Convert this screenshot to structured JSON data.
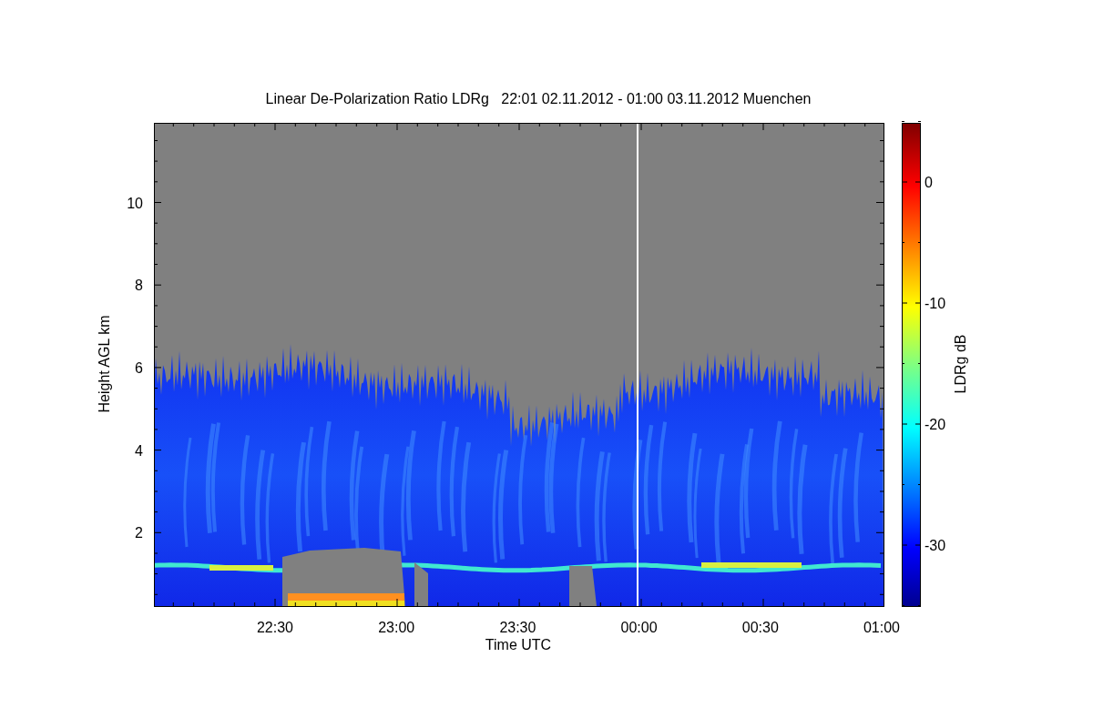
{
  "title": "Linear De-Polarization Ratio LDRg   22:01 02.11.2012 - 01:00 03.11.2012 Muenchen",
  "plot": {
    "ylabel": "Height AGL km",
    "xlabel": "Time UTC",
    "yticks": [
      "10",
      "8",
      "6",
      "4",
      "2"
    ],
    "xticks": [
      "22:30",
      "23:00",
      "23:30",
      "00:00",
      "00:30",
      "01:00"
    ]
  },
  "colorbar": {
    "label": "LDRg dB",
    "ticks": [
      "0",
      "-10",
      "-20",
      "-30"
    ]
  }
}
